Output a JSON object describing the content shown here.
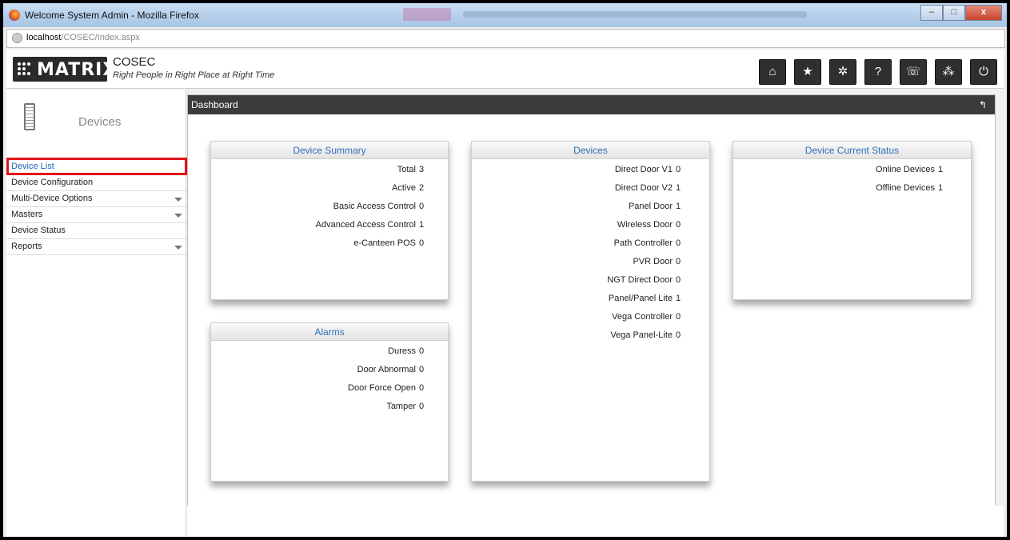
{
  "window": {
    "title": "Welcome System Admin - Mozilla Firefox",
    "buttons": {
      "minimize": "–",
      "maximize": "□",
      "close": "x"
    }
  },
  "address": {
    "host": "localhost",
    "path": "/COSEC/Index.aspx"
  },
  "header": {
    "logo_text": "MATRIX",
    "product": "COSEC",
    "tagline": "Right People in Right Place at Right Time",
    "toolbar": [
      {
        "name": "home-icon",
        "glyph": "⌂"
      },
      {
        "name": "star-icon",
        "glyph": "★"
      },
      {
        "name": "gear-icon",
        "glyph": "✲"
      },
      {
        "name": "help-icon",
        "glyph": "?"
      },
      {
        "name": "phone-icon",
        "glyph": "☏"
      },
      {
        "name": "grid-icon",
        "glyph": "⁂"
      },
      {
        "name": "power-icon",
        "glyph": "⏻"
      }
    ]
  },
  "sidebar": {
    "title": "Devices",
    "items": [
      {
        "label": "Device List",
        "active": true,
        "has_sub": false
      },
      {
        "label": "Device Configuration",
        "has_sub": false
      },
      {
        "label": "Multi-Device Options",
        "has_sub": true
      },
      {
        "label": "Masters",
        "has_sub": true
      },
      {
        "label": "Device Status",
        "has_sub": false
      },
      {
        "label": "Reports",
        "has_sub": true
      }
    ]
  },
  "dashboard": {
    "title": "Dashboard",
    "refresh_glyph": "↰",
    "device_summary": {
      "title": "Device Summary",
      "rows": [
        {
          "label": "Total",
          "value": "3"
        },
        {
          "label": "Active",
          "value": "2"
        },
        {
          "label": "Basic Access Control",
          "value": "0"
        },
        {
          "label": "Advanced Access Control",
          "value": "1"
        },
        {
          "label": "e-Canteen POS",
          "value": "0"
        }
      ]
    },
    "alarms": {
      "title": "Alarms",
      "rows": [
        {
          "label": "Duress",
          "value": "0"
        },
        {
          "label": "Door Abnormal",
          "value": "0"
        },
        {
          "label": "Door Force Open",
          "value": "0"
        },
        {
          "label": "Tamper",
          "value": "0"
        }
      ]
    },
    "devices": {
      "title": "Devices",
      "rows": [
        {
          "label": "Direct Door V1",
          "value": "0"
        },
        {
          "label": "Direct Door V2",
          "value": "1"
        },
        {
          "label": "Panel Door",
          "value": "1"
        },
        {
          "label": "Wireless Door",
          "value": "0"
        },
        {
          "label": "Path Controller",
          "value": "0"
        },
        {
          "label": "PVR Door",
          "value": "0"
        },
        {
          "label": "NGT Direct Door",
          "value": "0"
        },
        {
          "label": "Panel/Panel Lite",
          "value": "1"
        },
        {
          "label": "Vega Controller",
          "value": "0"
        },
        {
          "label": "Vega Panel-Lite",
          "value": "0"
        }
      ]
    },
    "current_status": {
      "title": "Device Current Status",
      "rows": [
        {
          "label": "Online Devices",
          "value": "1"
        },
        {
          "label": "Offline Devices",
          "value": "1"
        }
      ]
    }
  }
}
